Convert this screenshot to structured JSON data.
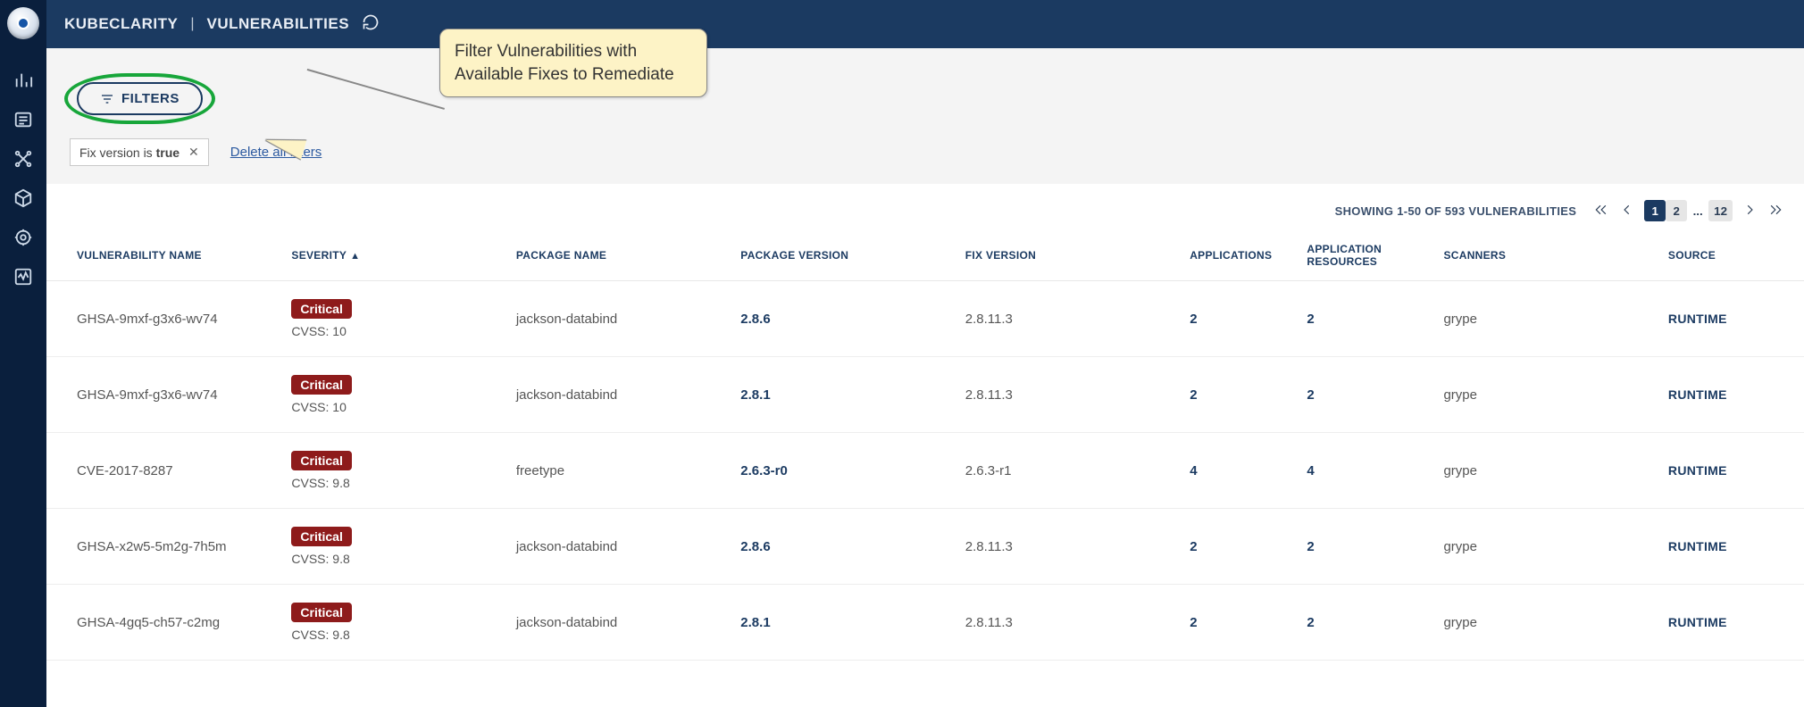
{
  "header": {
    "app": "KUBECLARITY",
    "divider": "|",
    "section": "VULNERABILITIES"
  },
  "filtersButton": "FILTERS",
  "callout": "Filter Vulnerabilities with Available Fixes to Remediate",
  "activeFilters": [
    {
      "label": "Fix version is ",
      "value": "true"
    }
  ],
  "deleteAllFilters": "Delete all filters",
  "pagination": {
    "summary": "SHOWING 1-50 OF 593 VULNERABILITIES",
    "pages": [
      "1",
      "2",
      "...",
      "12"
    ],
    "active": "1"
  },
  "columns": [
    "VULNERABILITY NAME",
    "SEVERITY",
    "PACKAGE NAME",
    "PACKAGE VERSION",
    "FIX VERSION",
    "APPLICATIONS",
    "APPLICATION RESOURCES",
    "SCANNERS",
    "SOURCE"
  ],
  "sortArrow": "▲",
  "cvssPrefix": "CVSS: ",
  "rows": [
    {
      "name": "GHSA-9mxf-g3x6-wv74",
      "severity": "Critical",
      "cvss": "10",
      "pkg": "jackson-databind",
      "pkgVer": "2.8.6",
      "fixVer": "2.8.11.3",
      "apps": "2",
      "appRes": "2",
      "scanners": "grype",
      "source": "RUNTIME"
    },
    {
      "name": "GHSA-9mxf-g3x6-wv74",
      "severity": "Critical",
      "cvss": "10",
      "pkg": "jackson-databind",
      "pkgVer": "2.8.1",
      "fixVer": "2.8.11.3",
      "apps": "2",
      "appRes": "2",
      "scanners": "grype",
      "source": "RUNTIME"
    },
    {
      "name": "CVE-2017-8287",
      "severity": "Critical",
      "cvss": "9.8",
      "pkg": "freetype",
      "pkgVer": "2.6.3-r0",
      "fixVer": "2.6.3-r1",
      "apps": "4",
      "appRes": "4",
      "scanners": "grype",
      "source": "RUNTIME"
    },
    {
      "name": "GHSA-x2w5-5m2g-7h5m",
      "severity": "Critical",
      "cvss": "9.8",
      "pkg": "jackson-databind",
      "pkgVer": "2.8.6",
      "fixVer": "2.8.11.3",
      "apps": "2",
      "appRes": "2",
      "scanners": "grype",
      "source": "RUNTIME"
    },
    {
      "name": "GHSA-4gq5-ch57-c2mg",
      "severity": "Critical",
      "cvss": "9.8",
      "pkg": "jackson-databind",
      "pkgVer": "2.8.1",
      "fixVer": "2.8.11.3",
      "apps": "2",
      "appRes": "2",
      "scanners": "grype",
      "source": "RUNTIME"
    }
  ]
}
